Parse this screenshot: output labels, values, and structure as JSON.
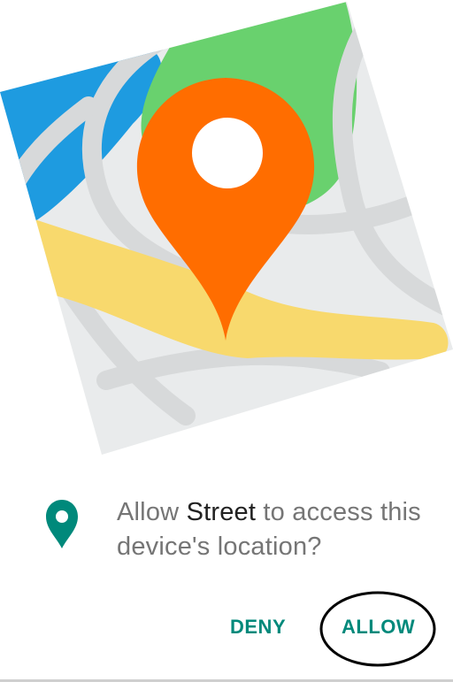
{
  "dialog": {
    "prompt_prefix": "Allow ",
    "app_name": "Street",
    "prompt_suffix": " to access this device's location?",
    "deny_label": "DENY",
    "allow_label": "ALLOW"
  },
  "icons": {
    "illustration": "map-illustration-icon",
    "location": "location-pin-icon"
  },
  "colors": {
    "accent": "#00897b",
    "pin_orange": "#ff6d00",
    "map_blue": "#1e9be0",
    "map_green": "#69d16e",
    "map_yellow": "#f8d96d",
    "map_land": "#e9ebec",
    "map_roads": "#d7d9da"
  }
}
